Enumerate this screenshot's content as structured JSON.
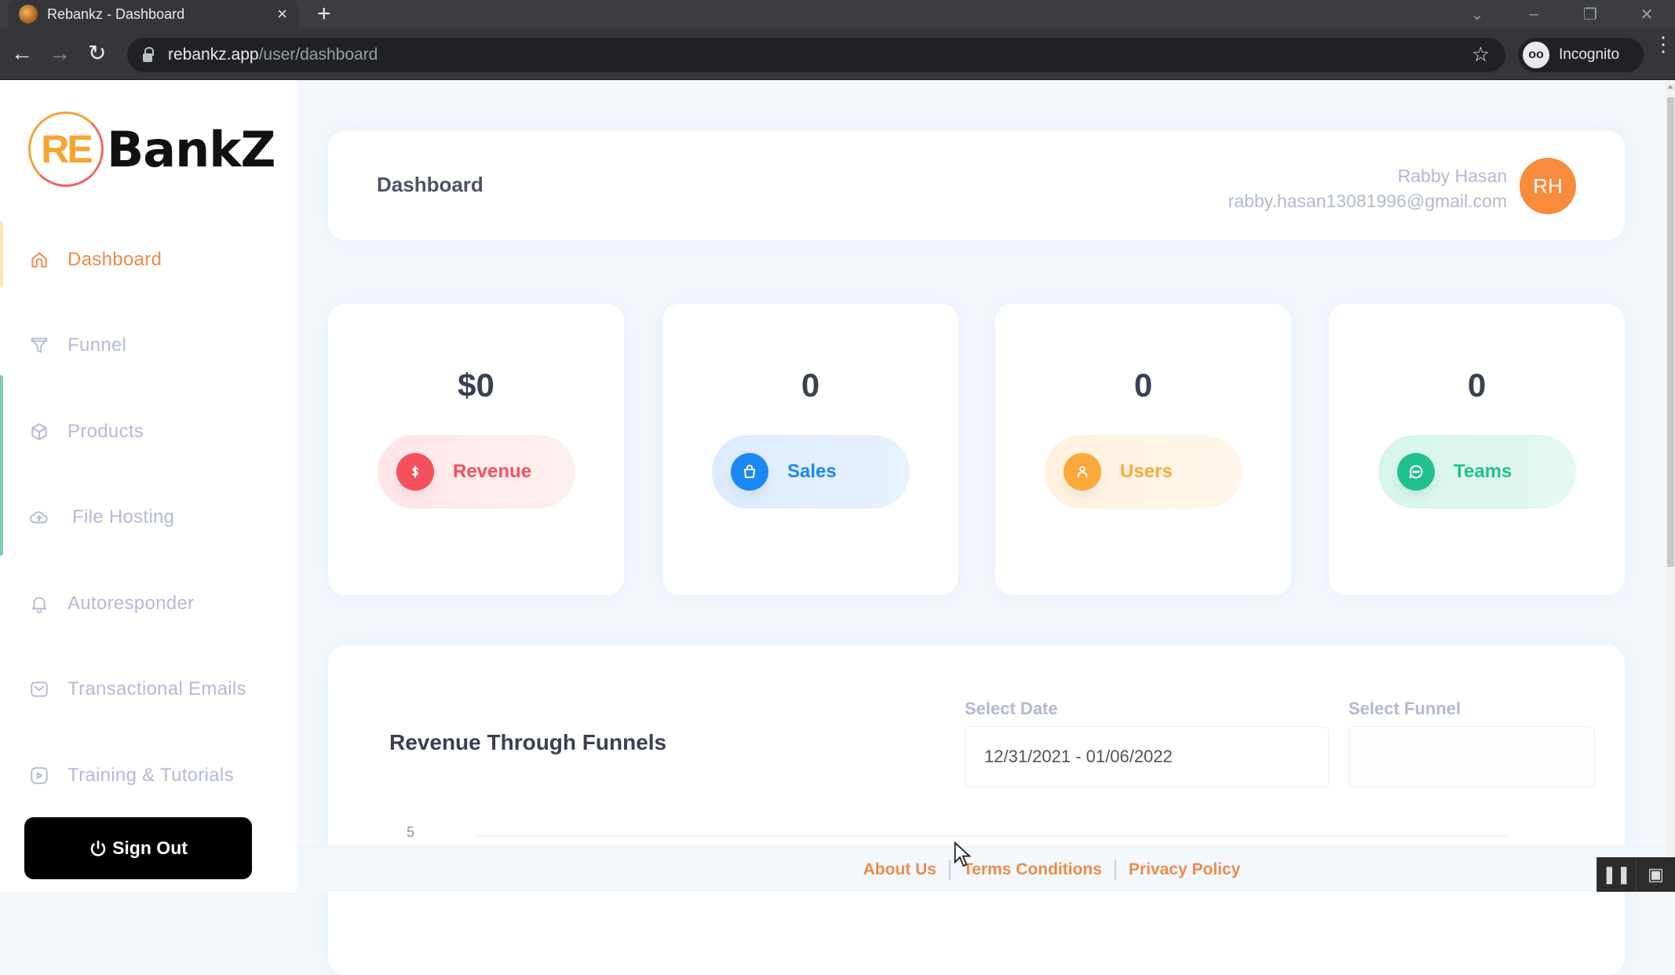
{
  "browser": {
    "tab_title": "Rebankz - Dashboard",
    "new_tab_glyph": "+",
    "close_glyph": "×",
    "url_host": "rebankz.app",
    "url_path": "/user/dashboard",
    "profile_label": "Incognito"
  },
  "sidebar": {
    "logo_re": "RE",
    "logo_text": "BankZ",
    "items": [
      {
        "label": "Dashboard",
        "icon": "home-icon",
        "active": true
      },
      {
        "label": "Funnel",
        "icon": "funnel-icon",
        "active": false
      },
      {
        "label": "Products",
        "icon": "box-icon",
        "active": false
      },
      {
        "label": "File Hosting",
        "icon": "cloud-upload-icon",
        "active": false
      },
      {
        "label": "Autoresponder",
        "icon": "bell-icon",
        "active": false
      },
      {
        "label": "Transactional Emails",
        "icon": "mail-icon",
        "active": false
      },
      {
        "label": "Training & Tutorials",
        "icon": "play-icon",
        "active": false
      }
    ],
    "signout_label": "Sign Out"
  },
  "header": {
    "title": "Dashboard",
    "user_name": "Rabby Hasan",
    "user_email": "rabby.hasan13081996@gmail.com",
    "avatar_initials": "RH"
  },
  "stats": [
    {
      "value": "$0",
      "label": "Revenue",
      "icon": "dollar-icon",
      "color": "#f6505e",
      "bg": "#ffe9ea"
    },
    {
      "value": "0",
      "label": "Sales",
      "icon": "shopping-bag-icon",
      "color": "#1a88f4",
      "bg": "#e2effe"
    },
    {
      "value": "0",
      "label": "Users",
      "icon": "user-icon",
      "color": "#fba93a",
      "bg": "#fff4e4"
    },
    {
      "value": "0",
      "label": "Teams",
      "icon": "chat-icon",
      "color": "#20c08f",
      "bg": "#dcf7ef"
    }
  ],
  "revenue_panel": {
    "title": "Revenue Through Funnels",
    "date_label": "Select Date",
    "date_value": "12/31/2021 - 01/06/2022",
    "funnel_label": "Select Funnel",
    "funnel_value": "",
    "y_tick_top": "5"
  },
  "footer": {
    "links": [
      "About Us",
      "Terms Conditions",
      "Privacy Policy"
    ]
  },
  "colors": {
    "accent": "#ee8a4a",
    "muted_text": "#b5bad6",
    "avatar": "#f98b3c"
  }
}
